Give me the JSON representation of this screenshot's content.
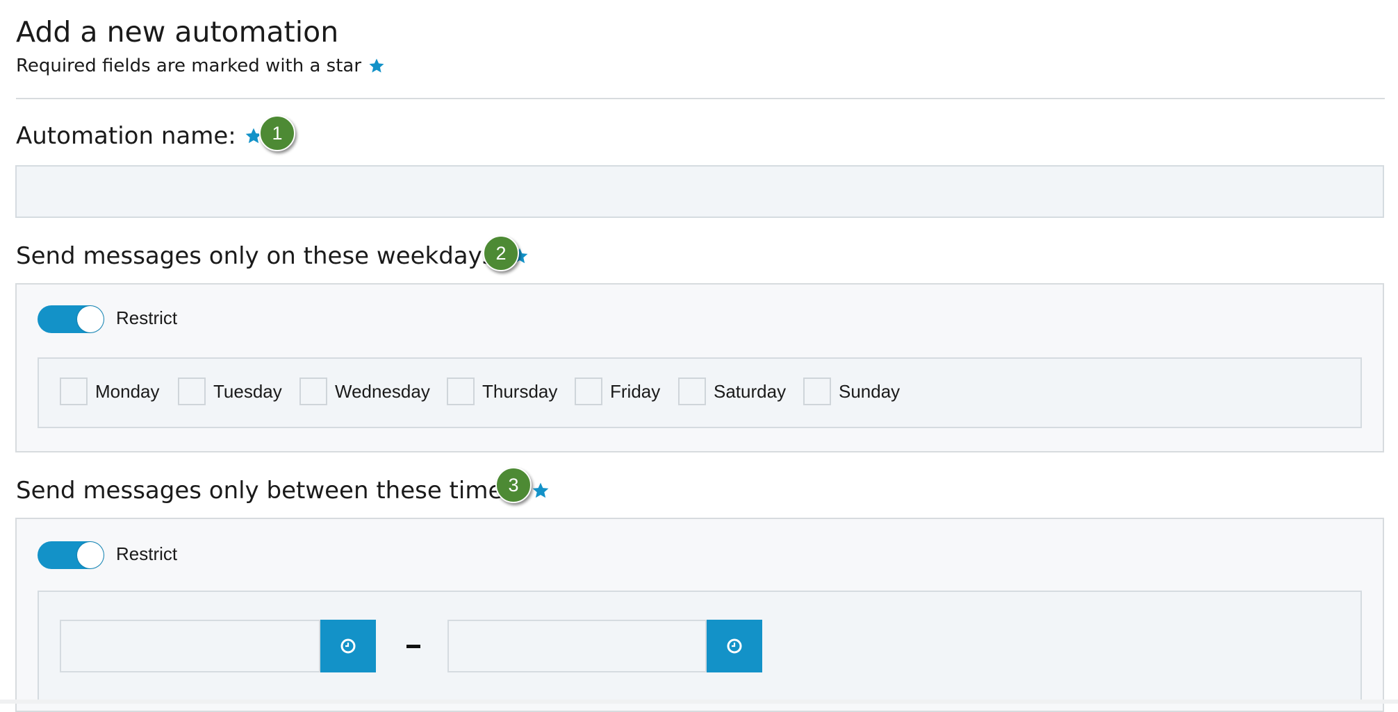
{
  "header": {
    "title": "Add a new automation",
    "subtitle": "Required fields are marked with a star"
  },
  "sections": {
    "name": {
      "label": "Automation name:",
      "step": "1",
      "input_value": ""
    },
    "weekdays": {
      "label": "Send messages only on these weekdays:",
      "step": "2",
      "toggle_label": "Restrict",
      "toggle_on": true,
      "days": [
        "Monday",
        "Tuesday",
        "Wednesday",
        "Thursday",
        "Friday",
        "Saturday",
        "Sunday"
      ]
    },
    "times": {
      "label": "Send messages only between these times:",
      "step": "3",
      "toggle_label": "Restrict",
      "toggle_on": true,
      "separator": "-",
      "start_value": "",
      "end_value": ""
    }
  },
  "icons": {
    "required": "star-icon",
    "time_picker": "clock-icon"
  },
  "colors": {
    "accent": "#1392c8",
    "badge": "#4d8a34",
    "input_bg": "#f2f5f8",
    "panel_bg": "#f7f8fa",
    "border": "#d7dbde"
  }
}
